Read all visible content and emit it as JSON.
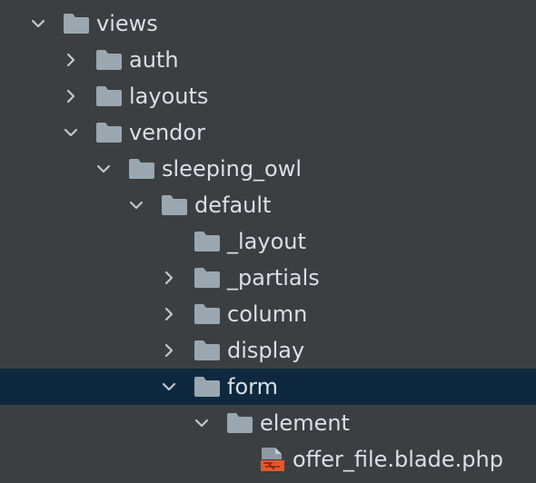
{
  "tree": {
    "items": [
      {
        "label": "views",
        "type": "folder",
        "depth": 0,
        "expanded": true,
        "icon": "folder-icon"
      },
      {
        "label": "auth",
        "type": "folder",
        "depth": 1,
        "expanded": false,
        "icon": "folder-icon"
      },
      {
        "label": "layouts",
        "type": "folder",
        "depth": 1,
        "expanded": false,
        "icon": "folder-icon"
      },
      {
        "label": "vendor",
        "type": "folder",
        "depth": 1,
        "expanded": true,
        "icon": "folder-icon"
      },
      {
        "label": "sleeping_owl",
        "type": "folder",
        "depth": 2,
        "expanded": true,
        "icon": "folder-icon"
      },
      {
        "label": "default",
        "type": "folder",
        "depth": 3,
        "expanded": true,
        "icon": "folder-icon"
      },
      {
        "label": "_layout",
        "type": "folder",
        "depth": 4,
        "expanded": null,
        "icon": "folder-icon"
      },
      {
        "label": "_partials",
        "type": "folder",
        "depth": 4,
        "expanded": false,
        "icon": "folder-icon"
      },
      {
        "label": "column",
        "type": "folder",
        "depth": 4,
        "expanded": false,
        "icon": "folder-icon"
      },
      {
        "label": "display",
        "type": "folder",
        "depth": 4,
        "expanded": false,
        "icon": "folder-icon"
      },
      {
        "label": "form",
        "type": "folder",
        "depth": 4,
        "expanded": true,
        "icon": "folder-icon",
        "selected": true
      },
      {
        "label": "element",
        "type": "folder",
        "depth": 5,
        "expanded": true,
        "icon": "folder-icon"
      },
      {
        "label": "offer_file.blade.php",
        "type": "file",
        "depth": 6,
        "expanded": null,
        "icon": "blade-file-icon"
      }
    ]
  },
  "colors": {
    "background": "#3c3f41",
    "selection": "#0e293f",
    "text": "#dcdfe4",
    "folder": "#9aa7b0",
    "chevron": "#c4c7cc",
    "blade_accent": "#e5582b"
  }
}
